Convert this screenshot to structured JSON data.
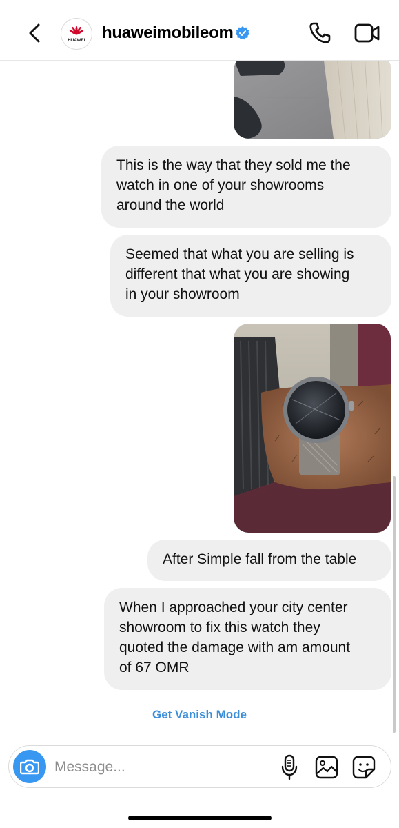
{
  "header": {
    "username": "huaweimobileom",
    "avatar_brand": "HUAWEI",
    "icons": {
      "back": "chevron-left-icon",
      "verified": "verified-badge-icon",
      "call": "phone-icon",
      "video": "video-camera-icon"
    }
  },
  "messages": [
    {
      "type": "image",
      "subject": "floor and shoes photo"
    },
    {
      "type": "text",
      "lines": [
        "This is the way that they sold me the",
        "watch in one of your showrooms",
        "around the world"
      ]
    },
    {
      "type": "text",
      "lines": [
        "Seemed that what you are selling is",
        "different that what you are showing",
        "in your showroom"
      ]
    },
    {
      "type": "image",
      "subject": "smartwatch on wrist photo"
    },
    {
      "type": "text",
      "lines": [
        "After Simple fall from the table"
      ]
    },
    {
      "type": "text",
      "lines": [
        "When I approached your city center",
        "showroom to fix this watch they",
        "quoted the damage with am amount",
        "of 67 OMR"
      ]
    }
  ],
  "vanish_mode_label": "Get Vanish Mode",
  "composer": {
    "placeholder": "Message...",
    "value": "",
    "icons": {
      "camera": "camera-icon",
      "mic": "microphone-icon",
      "gallery": "gallery-icon",
      "sticker": "sticker-icon"
    }
  },
  "colors": {
    "accent_blue": "#3897f0",
    "bubble_bg": "#efefef",
    "vanish_link": "#3a8ed9"
  }
}
